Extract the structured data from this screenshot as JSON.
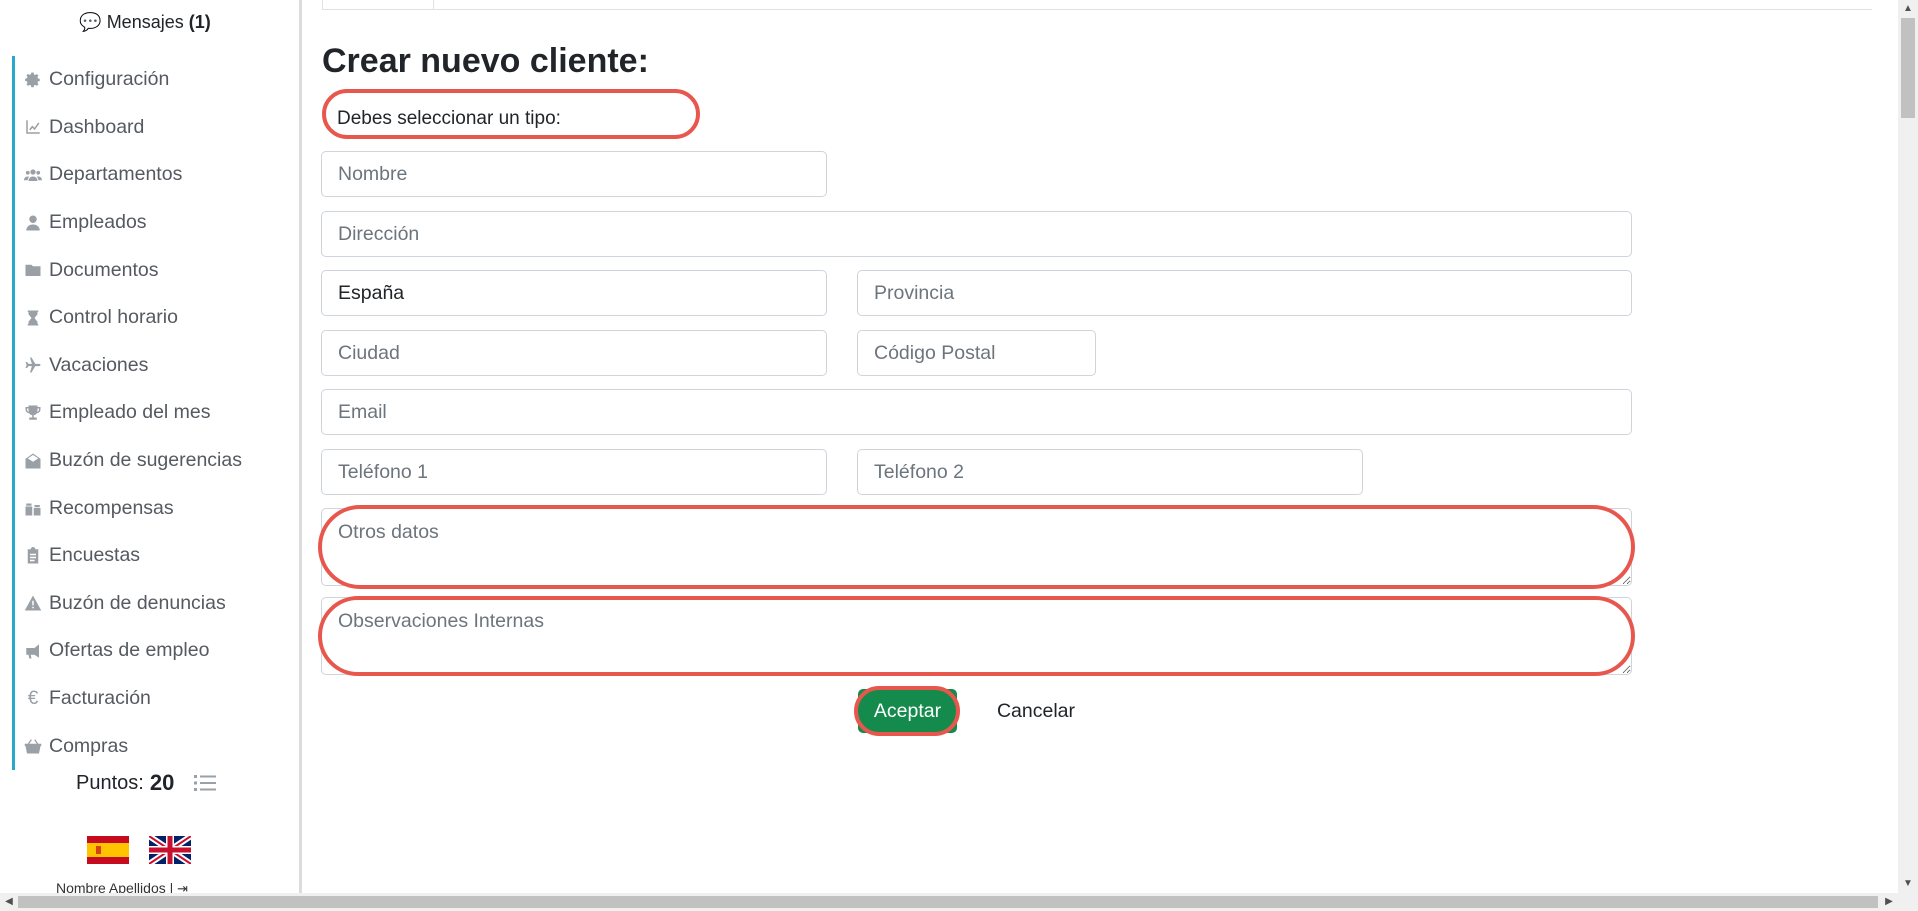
{
  "sidebar": {
    "messages_label": "Mensajes",
    "messages_count": "(1)",
    "items": [
      {
        "label": "Configuración",
        "icon": "gear-icon"
      },
      {
        "label": "Dashboard",
        "icon": "chart-line-icon"
      },
      {
        "label": "Departamentos",
        "icon": "users-icon"
      },
      {
        "label": "Empleados",
        "icon": "user-icon"
      },
      {
        "label": "Documentos",
        "icon": "folder-icon"
      },
      {
        "label": "Control horario",
        "icon": "hourglass-icon"
      },
      {
        "label": "Vacaciones",
        "icon": "plane-icon"
      },
      {
        "label": "Empleado del mes",
        "icon": "trophy-icon"
      },
      {
        "label": "Buzón de sugerencias",
        "icon": "envelope-open-icon"
      },
      {
        "label": "Recompensas",
        "icon": "gifts-icon"
      },
      {
        "label": "Encuestas",
        "icon": "clipboard-icon"
      },
      {
        "label": "Buzón de denuncias",
        "icon": "warning-icon"
      },
      {
        "label": "Ofertas de empleo",
        "icon": "megaphone-icon"
      },
      {
        "label": "Facturación",
        "icon": "euro-icon"
      },
      {
        "label": "Compras",
        "icon": "basket-icon"
      }
    ],
    "points_label": "Puntos:",
    "points_value": "20",
    "user_line": "Nombre Apellidos  |"
  },
  "form": {
    "title": "Crear nuevo cliente:",
    "type_prompt": "Debes seleccionar un tipo:",
    "nombre_placeholder": "Nombre",
    "direccion_placeholder": "Dirección",
    "pais_value": "España",
    "provincia_placeholder": "Provincia",
    "ciudad_placeholder": "Ciudad",
    "codigo_postal_placeholder": "Código Postal",
    "email_placeholder": "Email",
    "telefono1_placeholder": "Teléfono 1",
    "telefono2_placeholder": "Teléfono 2",
    "otros_datos_placeholder": "Otros datos",
    "observaciones_placeholder": "Observaciones Internas",
    "accept_label": "Aceptar",
    "cancel_label": "Cancelar"
  },
  "colors": {
    "accent_sidebar": "#28a9c9",
    "accept_button": "#158a4d",
    "highlight_ring": "#e8574d"
  }
}
